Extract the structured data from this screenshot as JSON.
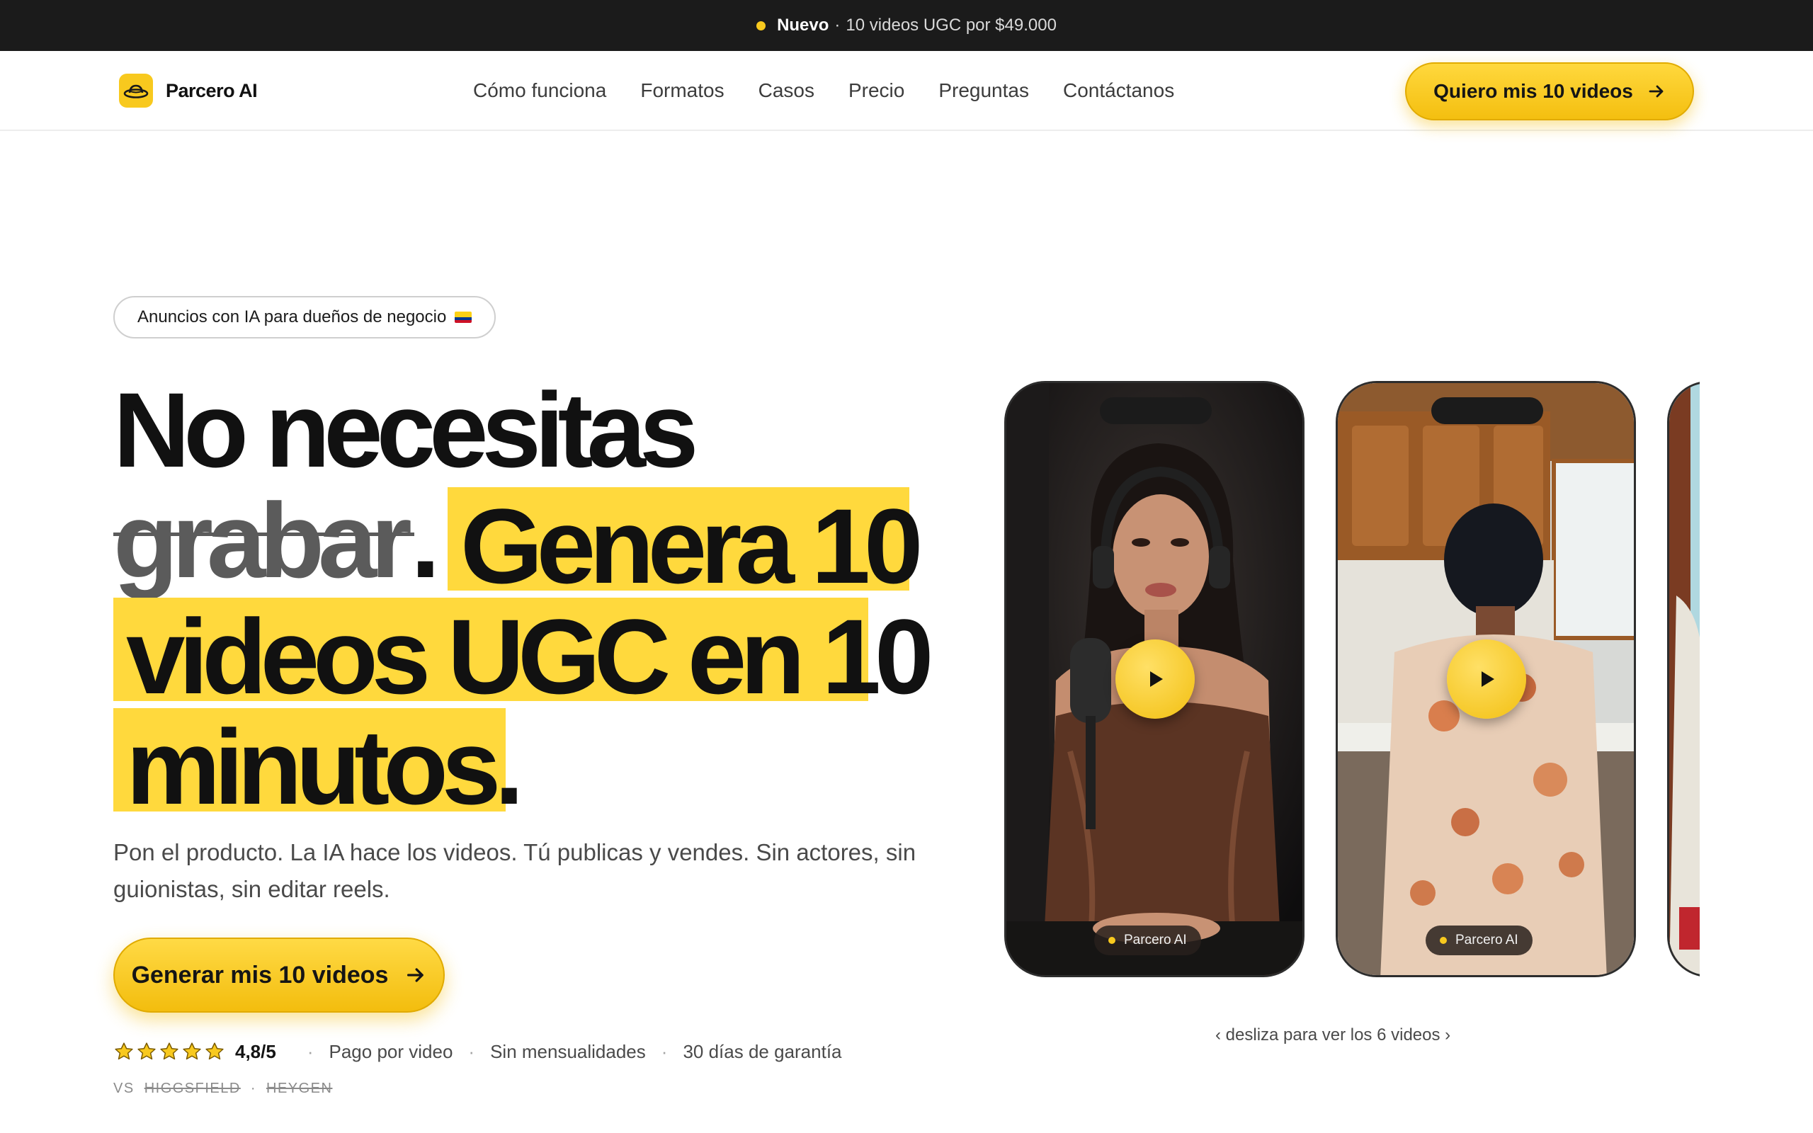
{
  "topbar": {
    "badge": "Nuevo",
    "separator": "·",
    "message": "10 videos UGC por $49.000"
  },
  "nav": {
    "brand": "Parcero AI",
    "links": [
      "Cómo funciona",
      "Formatos",
      "Casos",
      "Precio",
      "Preguntas",
      "Contáctanos"
    ],
    "cta": "Quiero mis 10 videos"
  },
  "hero": {
    "badge": "Anuncios con IA para dueños de negocio",
    "line1": "No necesitas",
    "struck": "grabar",
    "period": ".",
    "hl1": "Genera 10",
    "hl2": "videos UGC en 10",
    "hl3": "minutos.",
    "subtitle": "Pon el producto. La IA hace los videos. Tú publicas y vendes. Sin actores, sin guionistas, sin editar reels.",
    "cta": "Generar mis 10 videos",
    "rating": "4,8/5",
    "stars": 5,
    "trust": [
      "Pago por video",
      "Sin mensualidades",
      "30 días de garantía"
    ],
    "vs_label": "VS",
    "competitors": [
      "HIGGSFIELD",
      "HEYGEN"
    ]
  },
  "carousel": {
    "tag": "Parcero AI",
    "hint": "‹ desliza para ver los 6 videos ›"
  },
  "colors": {
    "accent": "#f8c91e",
    "highlight": "#ffd93d",
    "topbar": "#1b1b1b",
    "text": "#111111"
  },
  "icons": [
    "hat-logo-icon",
    "arrow-right-icon",
    "play-icon",
    "star-icon",
    "colombia-flag-icon"
  ]
}
